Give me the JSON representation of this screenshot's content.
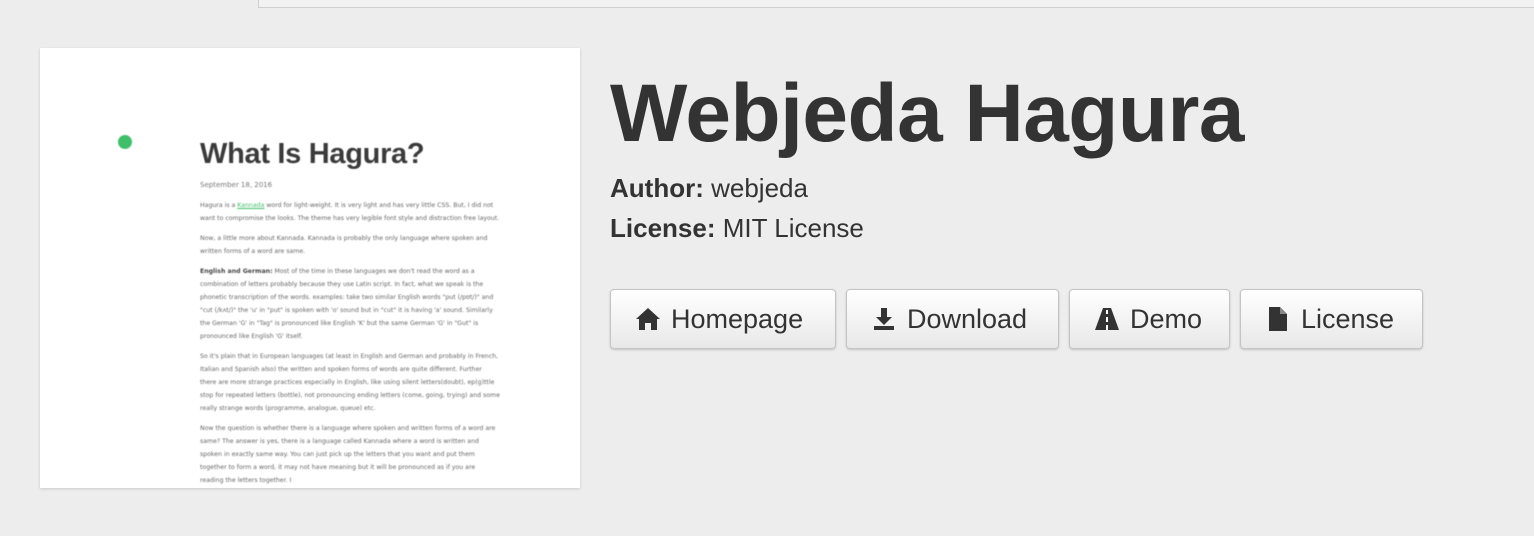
{
  "preview": {
    "title": "What Is Hagura?",
    "date": "September 18, 2016",
    "para1_pre": "Hagura is a ",
    "para1_link": "Kannada",
    "para1_post": " word for light-weight. It is very light and has very little CSS. But, I did not want to compromise the looks. The theme has very legible font style and distraction free layout.",
    "para2": "Now, a little more about Kannada. Kannada is probably the only language where spoken and written forms of a word are same.",
    "para3_strong": "English and German:",
    "para3": " Most of the time in these languages we don't read the word as a combination of letters probably because they use Latin script. In fact, what we speak is the phonetic transcription of the words. examples: take two similar English words \"put (/pʊt/)\" and \"cut (/kʌt/)\" the 'u' in \"put\" is spoken with 'o' sound but in \"cut\" it is having 'a' sound. Similarly the German 'G' in \"Tag\" is pronounced like English 'K' but the same German 'G' in \"Gut\" is pronounced like English 'G' itself.",
    "para4": "So it's plain that in European languages (at least in English and German and probably in French, Italian and Spanish also) the written and spoken forms of words are quite different. Further there are more strange practices especially in English, like using silent letters(doubt), ep(g)ttle stop for repeated letters (bottle), not pronouncing ending letters (come, going, trying) and some really strange words (programme, analogue, queue) etc.",
    "para5": "Now the question is whether there is a language where spoken and written forms of a word are same? The answer is yes, there is a language called Kannada where a word is written and spoken in exactly same way. You can just pick up the letters that you want and put them together to form a word, it may not have meaning but it will be pronounced as if you are reading the letters together. I"
  },
  "theme": {
    "title": "Webjeda Hagura",
    "author_label": "Author:",
    "author_value": "webjeda",
    "license_label": "License:",
    "license_value": "MIT License"
  },
  "buttons": {
    "homepage": "Homepage",
    "download": "Download",
    "demo": "Demo",
    "license": "License"
  },
  "icons": {
    "homepage": "home-icon",
    "download": "download-icon",
    "demo": "road-icon",
    "license": "file-icon"
  },
  "colors": {
    "background": "#ededed",
    "preview_accent": "#3fbf6a",
    "text": "#333333"
  }
}
